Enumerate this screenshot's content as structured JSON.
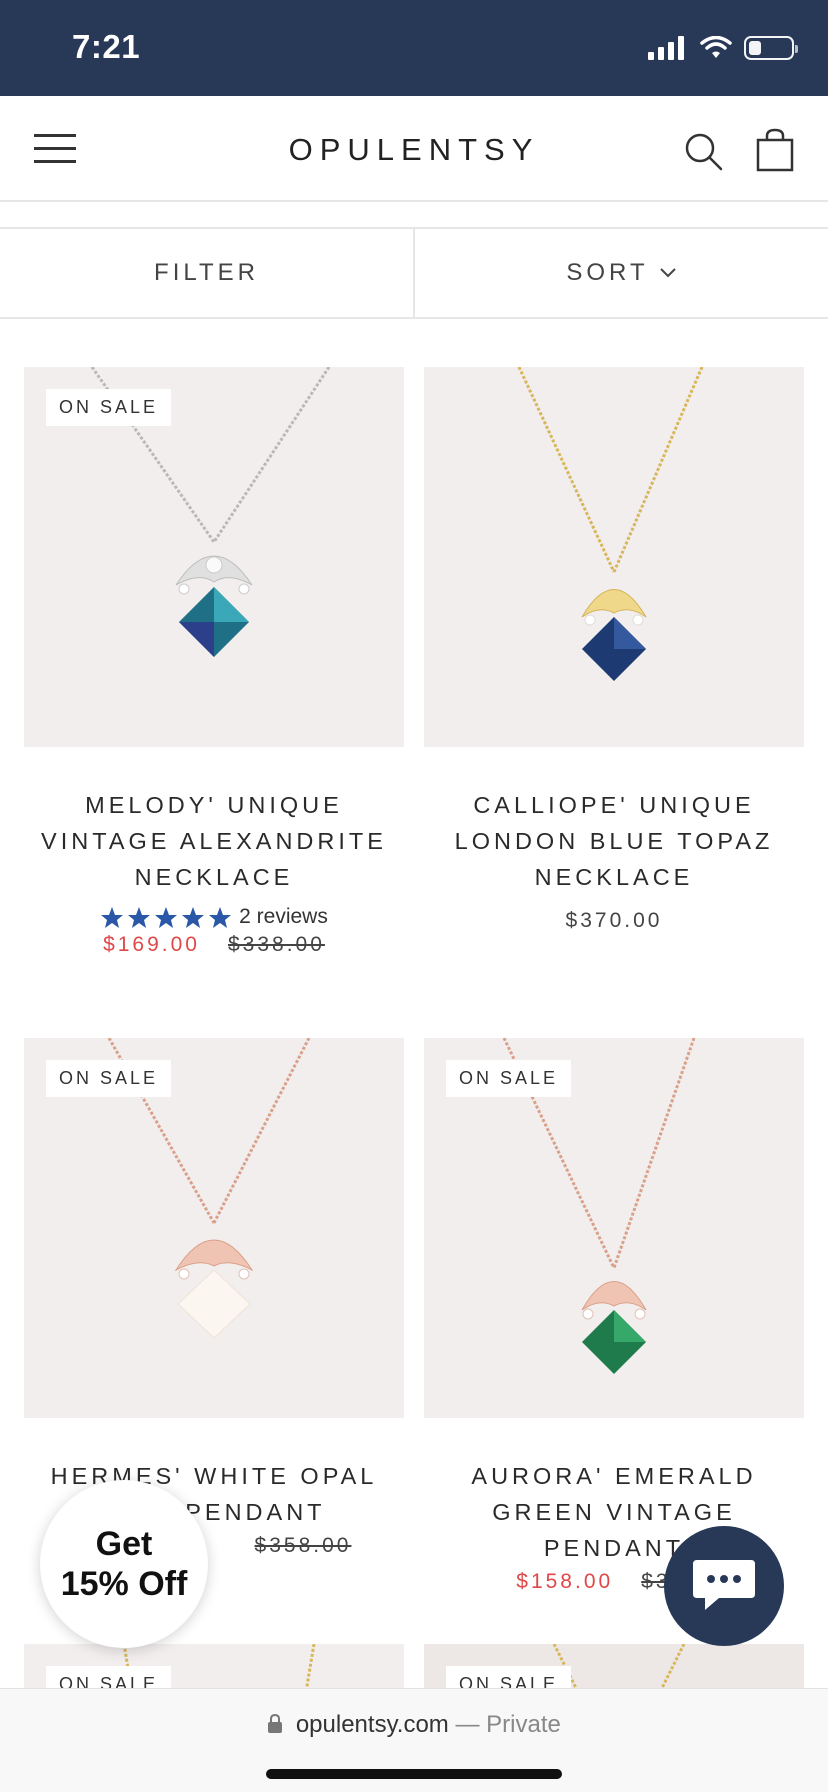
{
  "status": {
    "time": "7:21"
  },
  "header": {
    "brand": "OPULENTSY"
  },
  "toolbar": {
    "filter_label": "FILTER",
    "sort_label": "SORT"
  },
  "products": [
    {
      "badge": "ON SALE",
      "title": "MELODY' UNIQUE VINTAGE ALEXANDRITE NECKLACE",
      "rating": 5,
      "reviews": "2 reviews",
      "price": "$169.00",
      "compare_price": "$338.00",
      "metal": "silver",
      "stone": "alexandrite"
    },
    {
      "badge": "",
      "title": "CALLIOPE' UNIQUE LONDON BLUE TOPAZ NECKLACE",
      "price": "$370.00",
      "metal": "gold",
      "stone": "london-blue-topaz"
    },
    {
      "badge": "ON SALE",
      "title": "HERMES' WHITE OPAL ...CE PENDANT",
      "price": "",
      "compare_price": "$358.00",
      "metal": "rose-gold",
      "stone": "white-opal"
    },
    {
      "badge": "ON SALE",
      "title": "AURORA' EMERALD GREEN VINTAGE PENDANT",
      "price": "$158.00",
      "compare_price": "$31...",
      "metal": "rose-gold",
      "stone": "emerald"
    },
    {
      "badge": "ON SALE"
    },
    {
      "badge": "ON SALE"
    }
  ],
  "promo": {
    "line1": "Get",
    "line2": "15% Off"
  },
  "browser": {
    "domain": "opulentsy.com",
    "suffix": "— Private"
  },
  "colors": {
    "navy": "#283958",
    "sale_red": "#e04848",
    "star_blue": "#2b57a8"
  }
}
